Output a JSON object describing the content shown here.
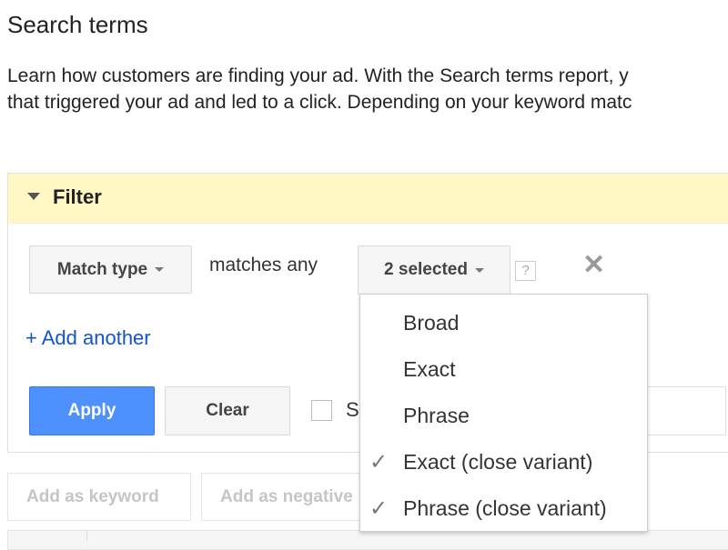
{
  "page": {
    "title": "Search terms",
    "description_lines": [
      "Learn how customers are finding your ad. With the Search terms report, y",
      "that triggered your ad and led to a click. Depending on your keyword matc"
    ]
  },
  "filter": {
    "label": "Filter",
    "field": "Match type",
    "operator": "matches any",
    "value": "2 selected",
    "help": "?",
    "add_another": "+ Add another",
    "apply": "Apply",
    "clear": "Clear",
    "checkbox_label": "S",
    "options": [
      {
        "label": "Broad",
        "checked": false
      },
      {
        "label": "Exact",
        "checked": false
      },
      {
        "label": "Phrase",
        "checked": false
      },
      {
        "label": "Exact (close variant)",
        "checked": true
      },
      {
        "label": "Phrase (close variant)",
        "checked": true
      }
    ]
  },
  "actions": {
    "add_keyword": "Add as keyword",
    "add_negative": "Add as negative"
  },
  "colors": {
    "accent": "#4d90fe",
    "link": "#1155cc",
    "filter_bg": "#fff8c5"
  }
}
